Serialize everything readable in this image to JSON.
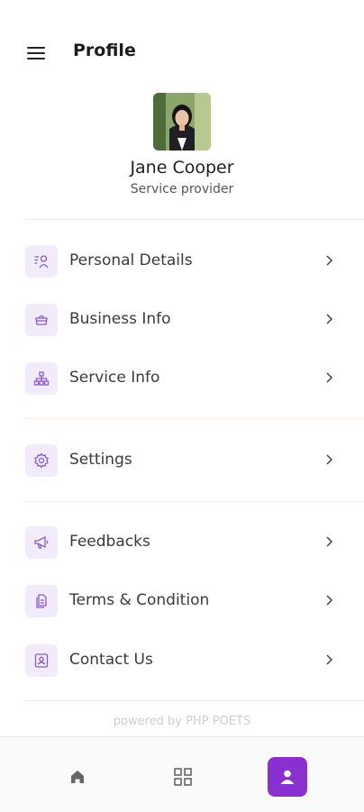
{
  "header": {
    "title": "Profile"
  },
  "profile": {
    "name": "Jane Cooper",
    "role": "Service provider"
  },
  "menu": {
    "personal_details": "Personal Details",
    "business_info": "Business Info",
    "service_info": "Service Info",
    "settings": "Settings",
    "feedbacks": "Feedbacks",
    "terms": "Terms & Condition",
    "contact": "Contact Us"
  },
  "footer": {
    "powered_by": "powered by PHP POETS"
  },
  "bottom_nav": {
    "items": [
      "home-icon",
      "grid-icon",
      "profile-icon"
    ],
    "active": "profile-icon"
  },
  "colors": {
    "accent": "#8a2fd0",
    "icon_bg": "#f1ebfb",
    "divider": "#fbe9e2"
  }
}
